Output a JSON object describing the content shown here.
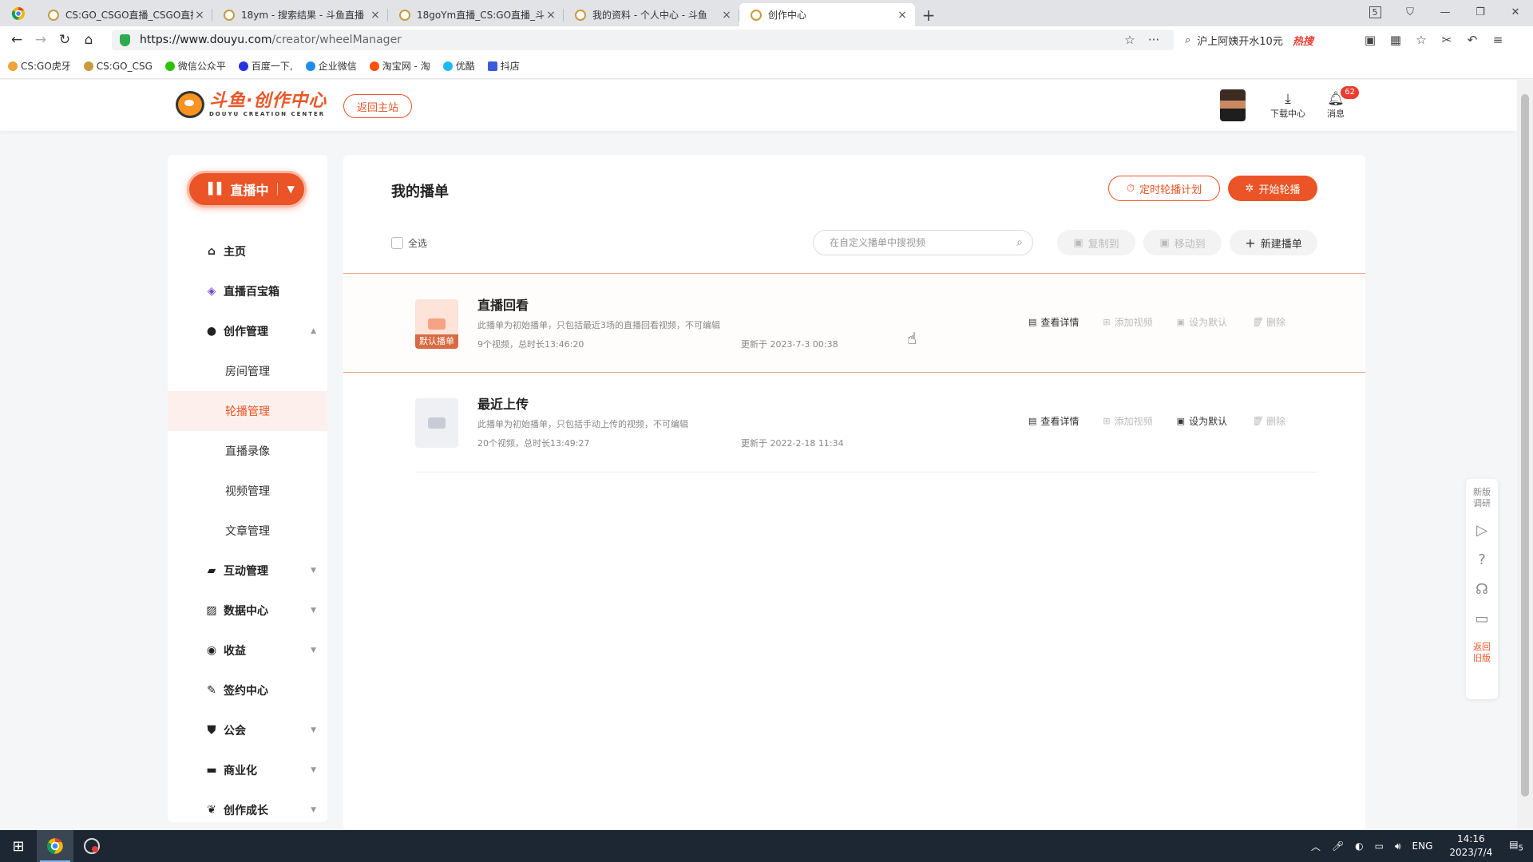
{
  "browser": {
    "tabs": [
      {
        "title": "CS:GO_CSGO直播_CSGO直播"
      },
      {
        "title": "18ym - 搜索结果 - 斗鱼直播"
      },
      {
        "title": "18goYm直播_CS:GO直播_斗"
      },
      {
        "title": "我的资料 - 个人中心 - 斗鱼"
      },
      {
        "title": "创作中心"
      }
    ],
    "active_tab": 4,
    "url_host": "https://www.douyu.com",
    "url_path": "/creator/wheelManager",
    "search_hint": "沪上阿姨开水10元",
    "hot_label": "热搜",
    "tab_count": "5",
    "bookmarks": [
      "CS:GO虎牙",
      "CS:GO_CSG",
      "微信公众平",
      "百度一下,",
      "企业微信",
      "淘宝网 - 淘",
      "优酷",
      "抖店"
    ]
  },
  "header": {
    "logo_cn": "斗鱼·创作中心",
    "logo_en": "DOUYU CREATION CENTER",
    "back_label": "返回主站",
    "download_label": "下载中心",
    "message_label": "消息",
    "message_count": "62"
  },
  "sidebar": {
    "live_label": "直播中",
    "items": [
      {
        "label": "主页",
        "icon": "home-icon"
      },
      {
        "label": "直播百宝箱",
        "icon": "cube-icon"
      },
      {
        "label": "创作管理",
        "icon": "bulb-icon"
      },
      {
        "label": "房间管理"
      },
      {
        "label": "轮播管理"
      },
      {
        "label": "直播录像"
      },
      {
        "label": "视频管理"
      },
      {
        "label": "文章管理"
      },
      {
        "label": "互动管理",
        "icon": "chat-icon"
      },
      {
        "label": "数据中心",
        "icon": "chart-icon"
      },
      {
        "label": "收益",
        "icon": "coin-icon"
      },
      {
        "label": "签约中心",
        "icon": "pen-icon"
      },
      {
        "label": "公会",
        "icon": "shield-icon"
      },
      {
        "label": "商业化",
        "icon": "briefcase-icon"
      },
      {
        "label": "创作成长",
        "icon": "sprout-icon"
      }
    ]
  },
  "main": {
    "title": "我的播单",
    "plan_label": "定时轮播计划",
    "start_label": "开始轮播",
    "select_all": "全选",
    "search_placeholder": "在自定义播单中搜视频",
    "copy_label": "复制到",
    "move_label": "移动到",
    "new_label": "新建播单",
    "playlists": [
      {
        "title": "直播回看",
        "badge": "默认播单",
        "desc": "此播单为初始播单，只包括最近3场的直播回看视频，不可编辑",
        "meta": "9个视频，总时长13:46:20",
        "updated": "更新于 2023-7-3 00:38",
        "actions": [
          "查看详情",
          "添加视频",
          "设为默认",
          "删除"
        ]
      },
      {
        "title": "最近上传",
        "desc": "此播单为初始播单，只包括手动上传的视频，不可编辑",
        "meta": "20个视频，总时长13:49:27",
        "updated": "更新于 2022-2-18 11:34",
        "actions": [
          "查看详情",
          "添加视频",
          "设为默认",
          "删除"
        ]
      }
    ]
  },
  "float": {
    "survey": "新版调研",
    "old": "返回旧版"
  },
  "taskbar": {
    "lang": "ENG",
    "time": "14:16",
    "date": "2023/7/4",
    "notif": "5"
  },
  "colors": {
    "accent": "#ea5426",
    "active_bg": "#fdf0ec"
  }
}
